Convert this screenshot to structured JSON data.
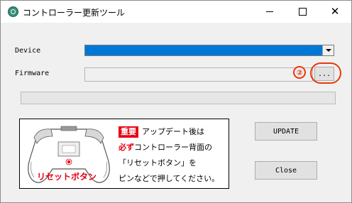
{
  "window": {
    "title": "コントローラー更新ツール",
    "close_glyph": "✕"
  },
  "form": {
    "device_label": "Device",
    "firmware_label": "Firmware",
    "browse_label": "...",
    "step_number": "②",
    "progress_percent": 0
  },
  "notice": {
    "badge": "重要",
    "line1_rest": "アップデート後は",
    "line2_emph": "必ず",
    "line2_rest": "コントローラー背面の",
    "line3": "「リセットボタン」を",
    "line4": "ピンなどで押してください。",
    "reset_caption": "リセットボタン"
  },
  "buttons": {
    "update": "UPDATE",
    "close": "Close"
  },
  "colors": {
    "accent_red": "#e60012",
    "annotation_orange": "#e8380d",
    "selection_blue": "#0078d7"
  }
}
